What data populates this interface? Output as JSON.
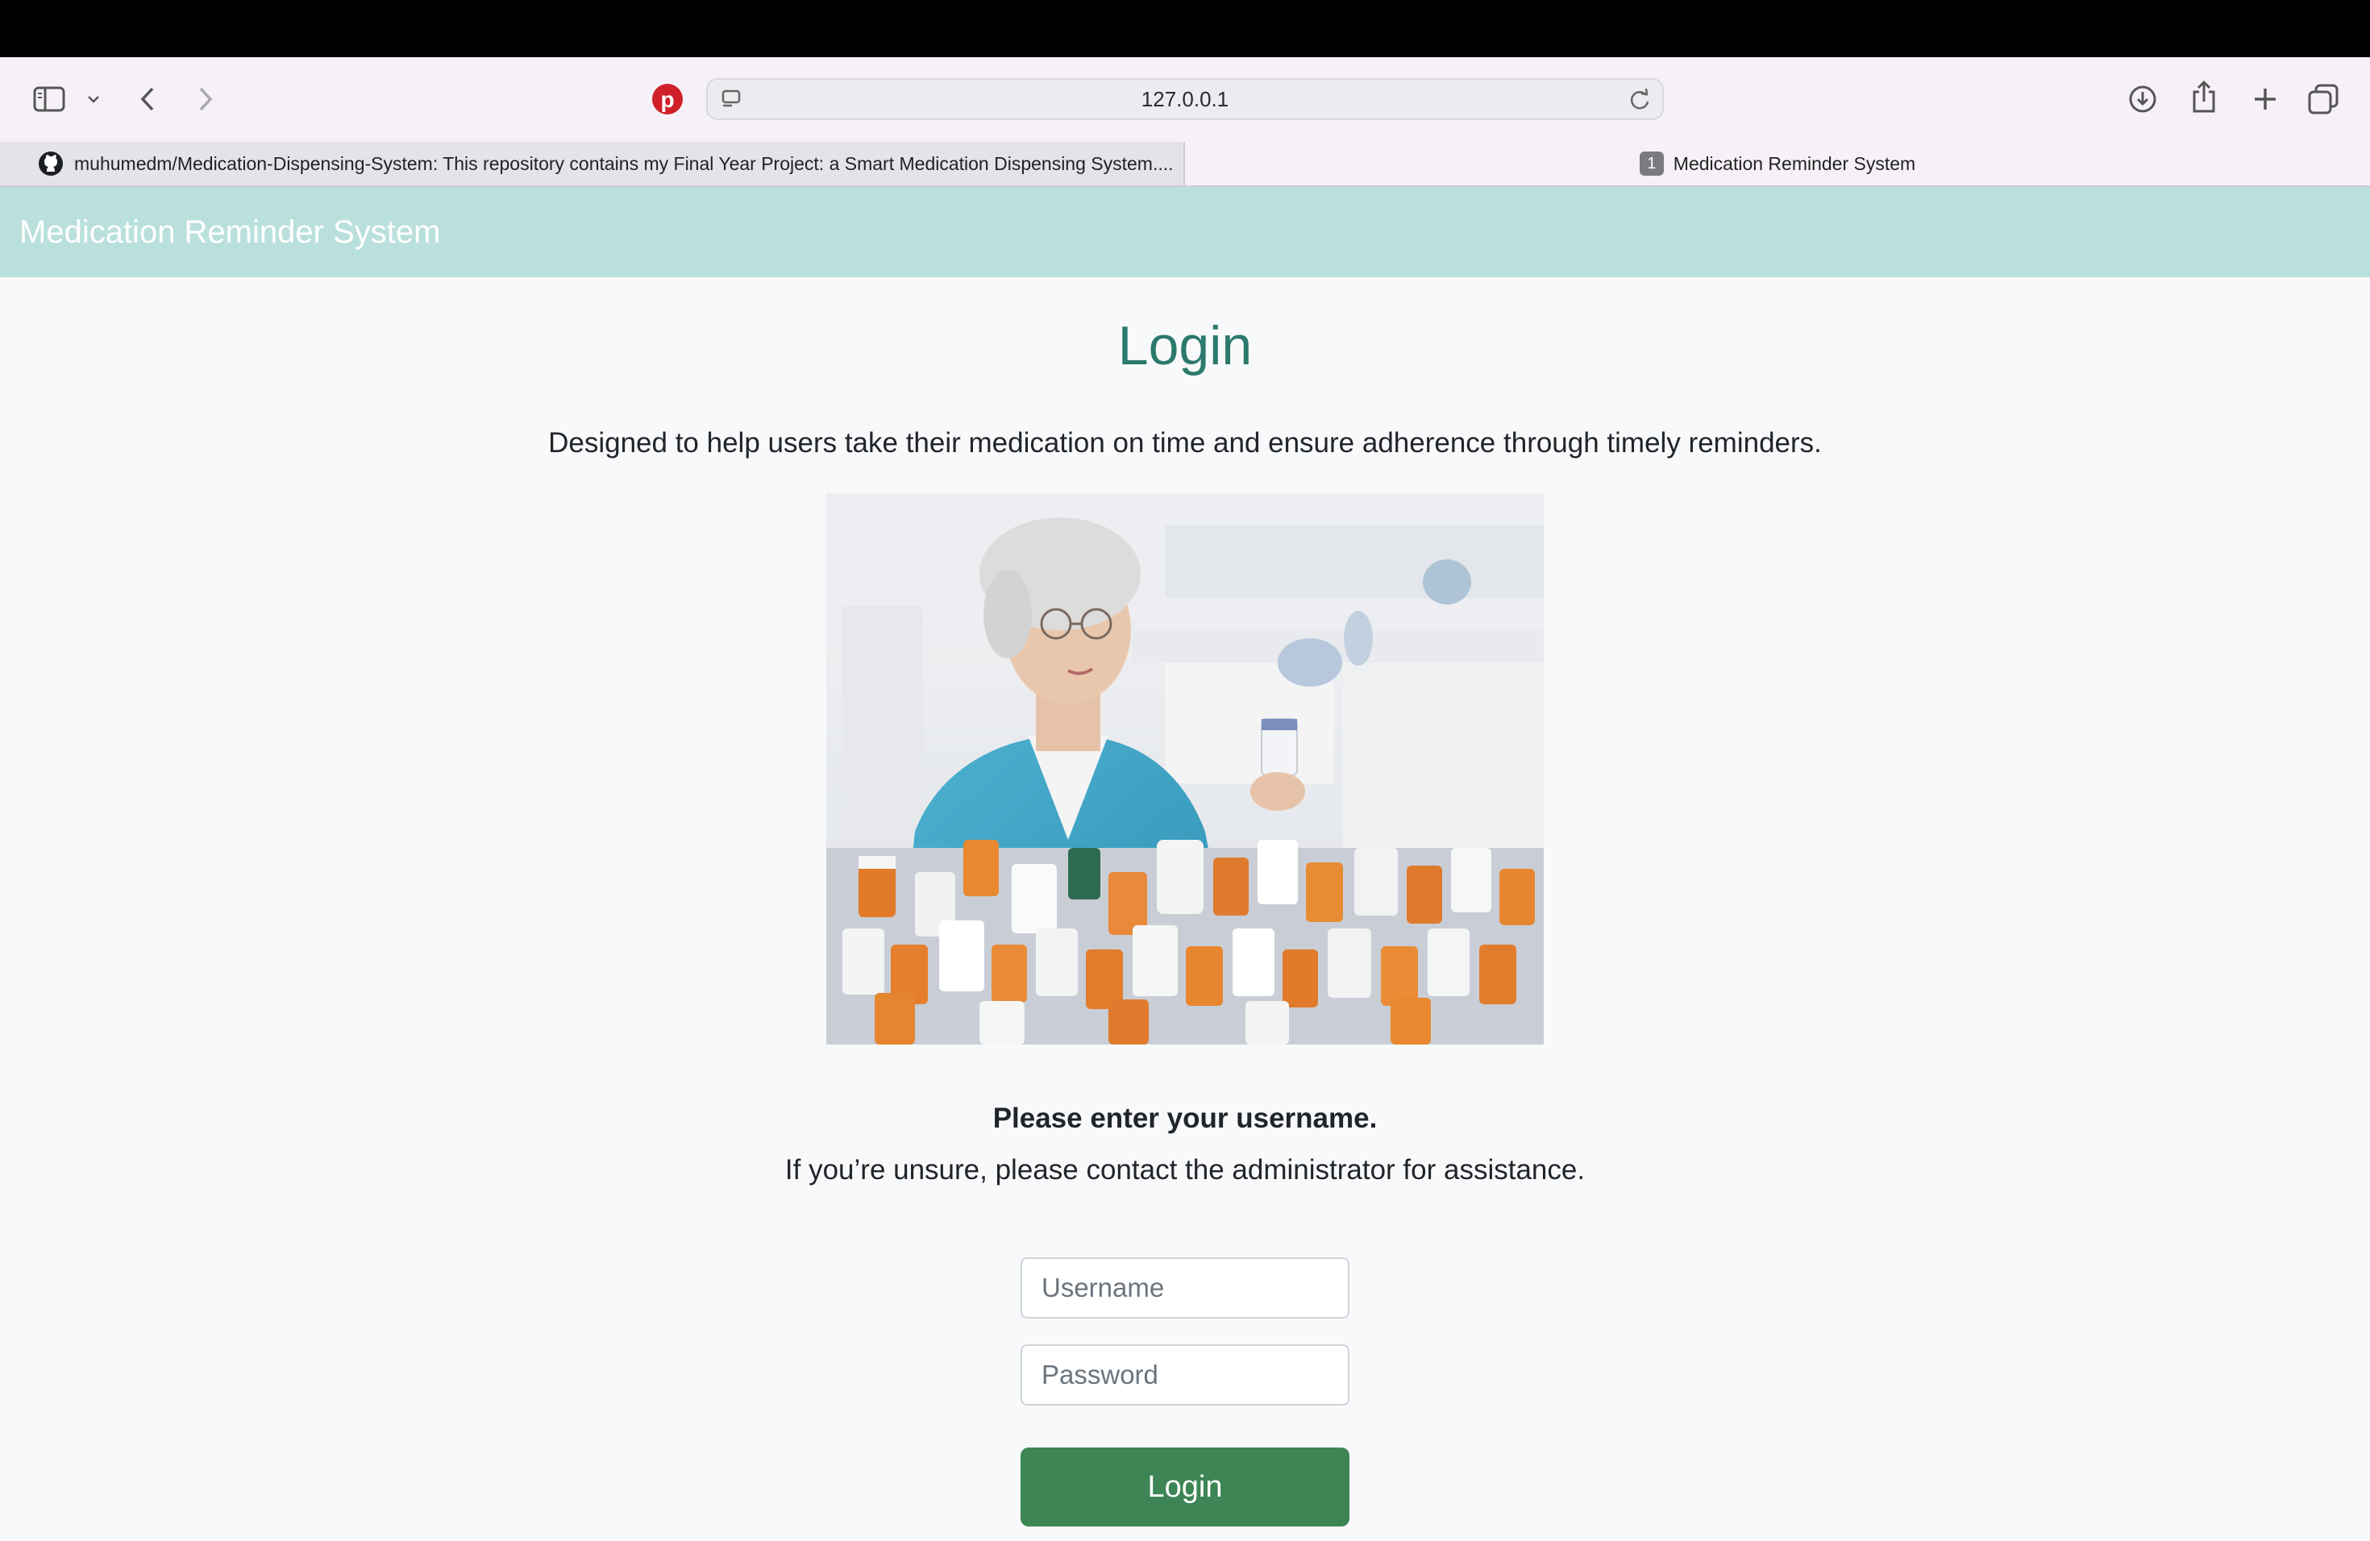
{
  "browser": {
    "url": "127.0.0.1",
    "tabs": [
      {
        "label": "muhumedm/Medication-Dispensing-System: This repository contains my Final Year Project: a Smart Medication Dispensing System....",
        "active": false,
        "icon": "github-icon"
      },
      {
        "label": "Medication Reminder System",
        "active": true,
        "badge": "1"
      }
    ]
  },
  "app": {
    "brand": "Medication Reminder System"
  },
  "login": {
    "title": "Login",
    "description": "Designed to help users take their medication on time and ensure adherence through timely reminders.",
    "prompt": "Please enter your username.",
    "help": "If you’re unsure, please contact the administrator for assistance.",
    "username_placeholder": "Username",
    "password_placeholder": "Password",
    "button": "Login"
  },
  "colors": {
    "navbar": "#bae0dd",
    "title": "#2b7a6c",
    "button": "#3d8555"
  }
}
